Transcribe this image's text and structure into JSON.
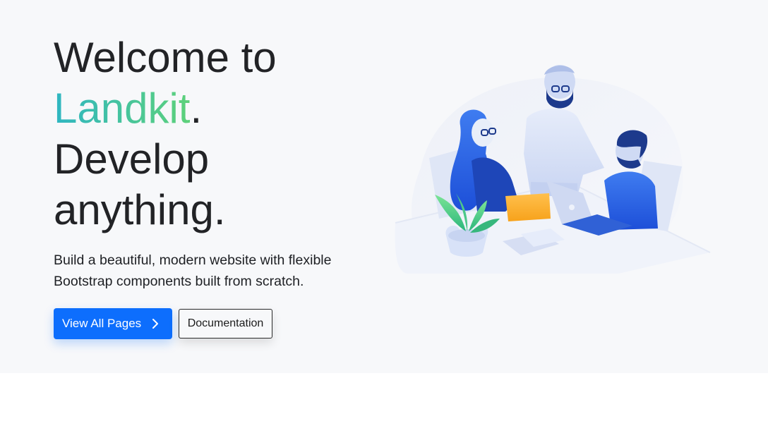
{
  "hero": {
    "headline": {
      "line1": "Welcome to",
      "brand": "Landkit",
      "brand_period": ".",
      "line3": "Develop",
      "line4": "anything."
    },
    "lead": "Build a beautiful, modern website with flexible Bootstrap components built from scratch.",
    "buttons": {
      "primary_label": "View All Pages",
      "secondary_label": "Documentation"
    },
    "illustration": {
      "name": "team-meeting-illustration"
    }
  },
  "colors": {
    "hero_background": "#f7f8fa",
    "primary": "#0d6efd",
    "brand_gradient_start": "#2fb6c2",
    "brand_gradient_end": "#5dd17a",
    "text": "#222326"
  }
}
